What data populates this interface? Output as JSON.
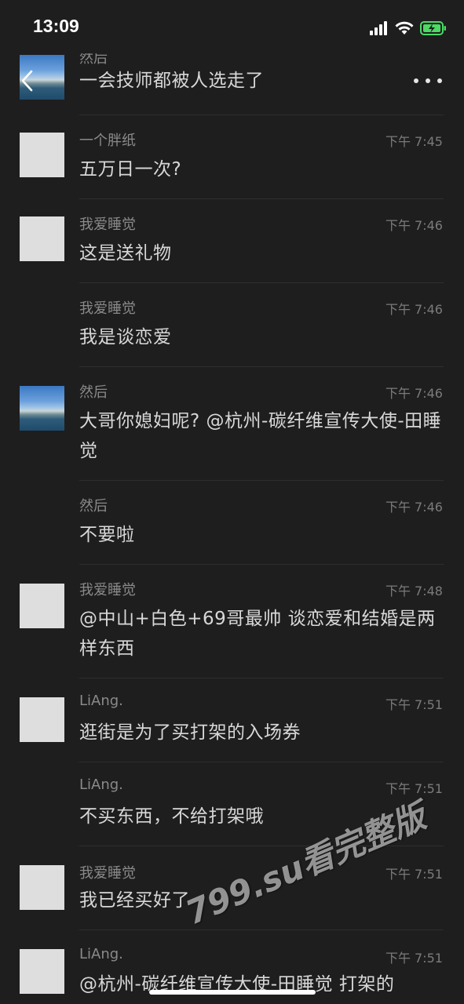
{
  "status_bar": {
    "time": "13:09"
  },
  "header": {
    "back_icon": "chevron-left-icon",
    "more_icon": "more-horizontal-icon"
  },
  "messages": [
    {
      "name": "然后",
      "time": "",
      "text": "一会技师都被人选走了",
      "avatar": "photo"
    },
    {
      "name": "一个胖纸",
      "time": "下午 7:45",
      "text": "五万日一次?",
      "avatar": "default"
    },
    {
      "name": "我爱睡觉",
      "time": "下午 7:46",
      "text": "这是送礼物",
      "avatar": "default"
    },
    {
      "name": "我爱睡觉",
      "time": "下午 7:46",
      "text": "我是谈恋爱",
      "avatar": ""
    },
    {
      "name": "然后",
      "time": "下午 7:46",
      "text": "大哥你媳妇呢? @杭州-碳纤维宣传大使-田睡觉",
      "avatar": "photo"
    },
    {
      "name": "然后",
      "time": "下午 7:46",
      "text": "不要啦",
      "avatar": ""
    },
    {
      "name": "我爱睡觉",
      "time": "下午 7:48",
      "text": "@中山+白色+69哥最帅 谈恋爱和结婚是两样东西",
      "avatar": "default"
    },
    {
      "name": "LiAng.",
      "time": "下午 7:51",
      "text": "逛街是为了买打架的入场券",
      "avatar": "default"
    },
    {
      "name": "LiAng.",
      "time": "下午 7:51",
      "text": "不买东西，不给打架哦",
      "avatar": ""
    },
    {
      "name": "我爱睡觉",
      "time": "下午 7:51",
      "text": "我已经买好了",
      "avatar": "default"
    },
    {
      "name": "LiAng.",
      "time": "下午 7:51",
      "text": "@杭州-碳纤维宣传大使-田睡觉 打架的",
      "avatar": "default"
    }
  ],
  "watermark": "799.su看完整版",
  "colors": {
    "background": "#1e1e1e",
    "text": "#d8d8d8",
    "meta": "#7b7b7b",
    "battery": "#4cd964"
  }
}
